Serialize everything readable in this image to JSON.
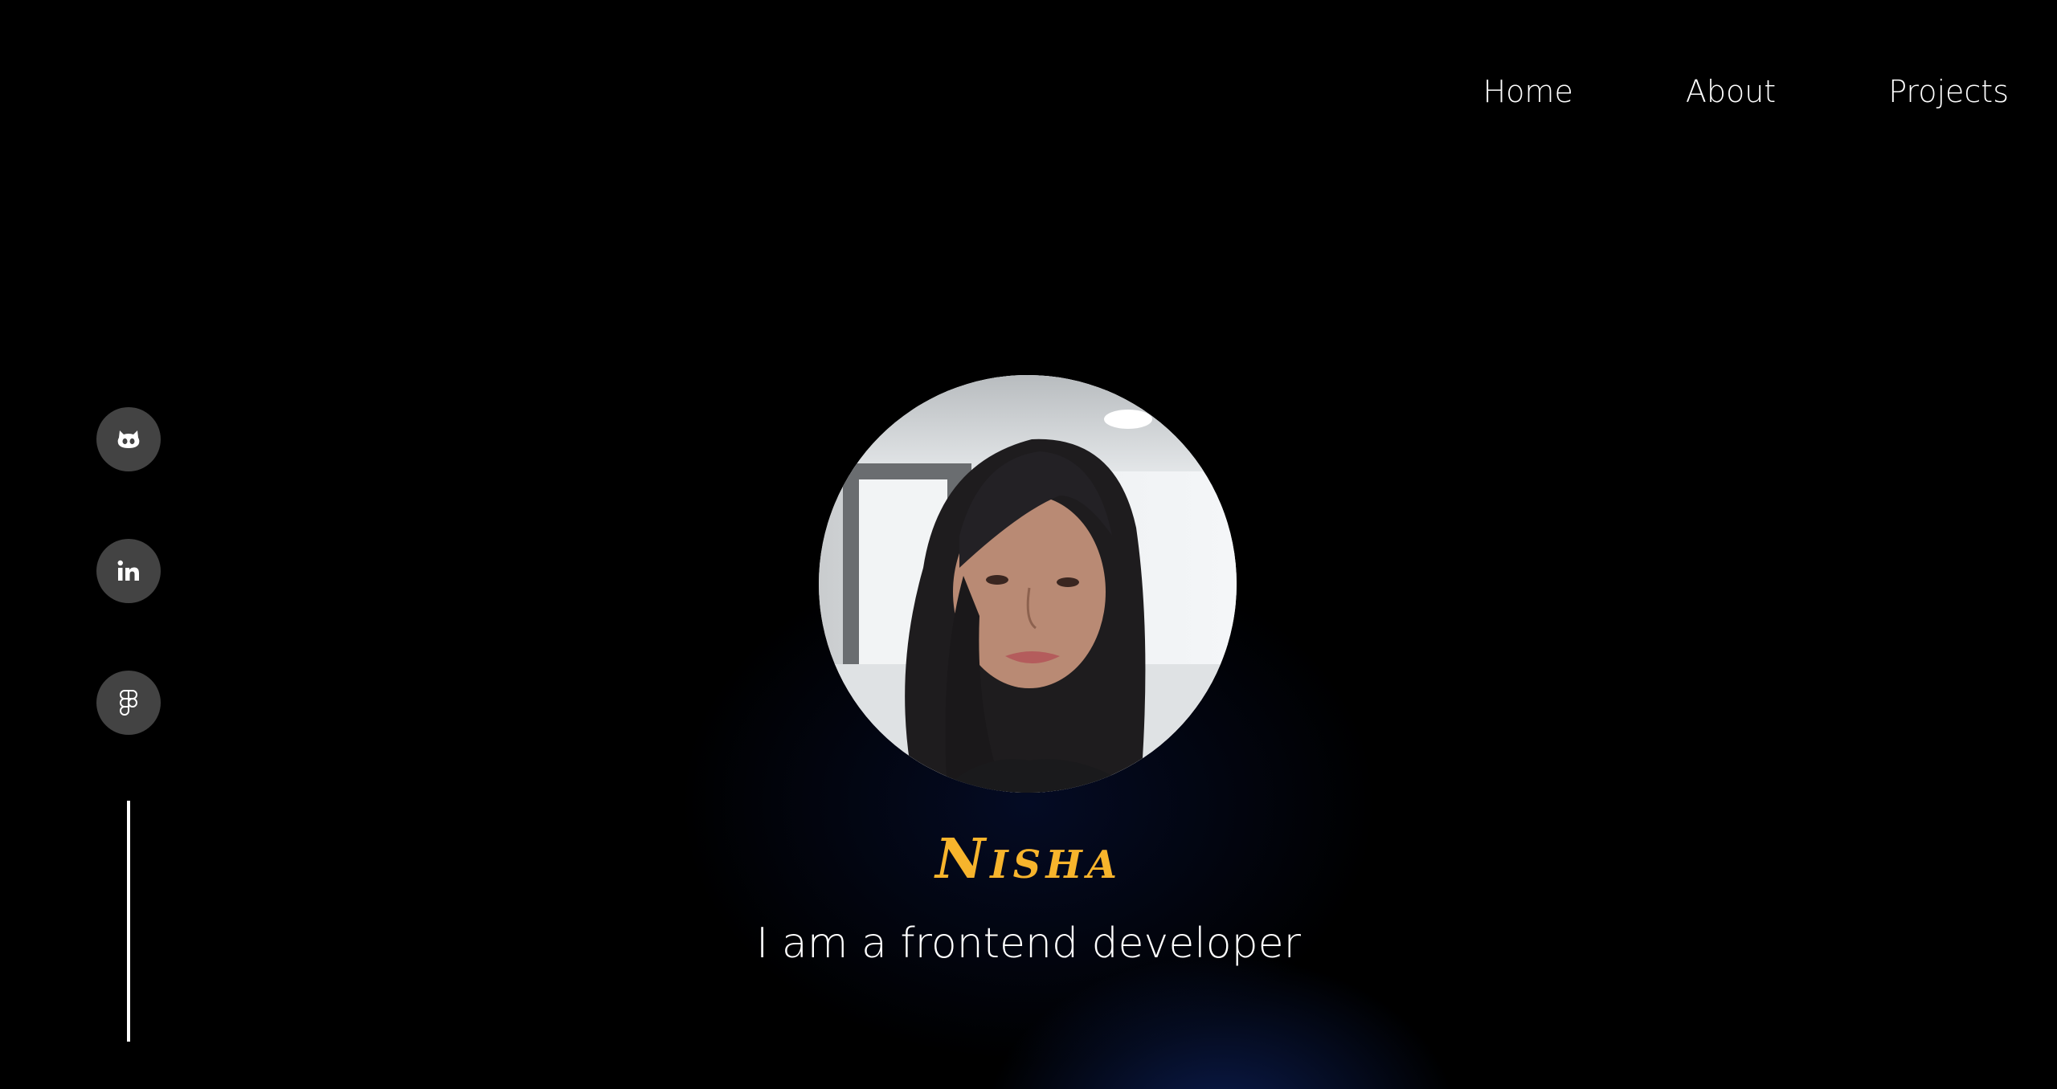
{
  "nav": {
    "links": [
      {
        "label": "Home"
      },
      {
        "label": "About"
      },
      {
        "label": "Projects"
      }
    ]
  },
  "social": {
    "items": [
      {
        "icon": "github-icon"
      },
      {
        "icon": "linkedin-icon"
      },
      {
        "icon": "figma-icon"
      }
    ],
    "button_color": "#434343"
  },
  "hero": {
    "name": "Nisha",
    "tagline": "I am a frontend developer",
    "name_color": "#f7b42c"
  }
}
